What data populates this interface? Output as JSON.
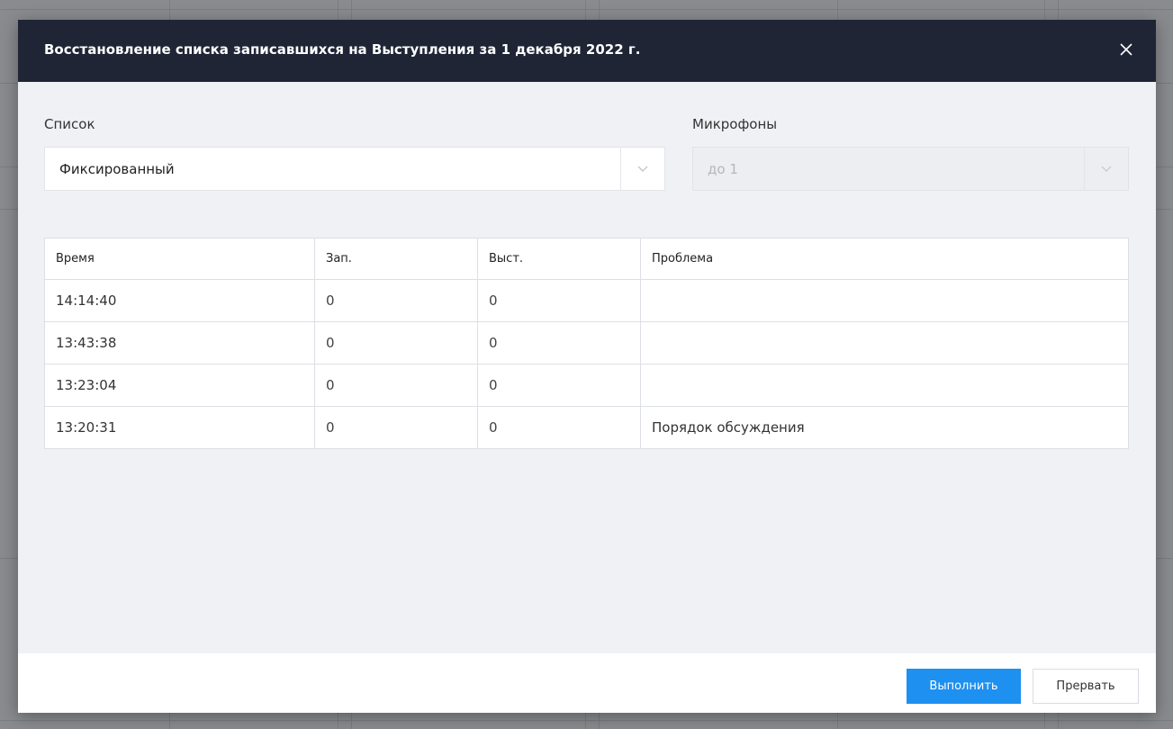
{
  "dialog": {
    "title": "Восстановление списка записавшихся на Выступления за 1 декабря 2022 г.",
    "close_icon": "close-icon"
  },
  "form": {
    "list_label": "Список",
    "list_value": "Фиксированный",
    "mics_label": "Микрофоны",
    "mics_value": "до 1"
  },
  "table": {
    "columns": [
      "Время",
      "Зап.",
      "Выст.",
      "Проблема"
    ],
    "rows": [
      [
        "14:14:40",
        "0",
        "0",
        ""
      ],
      [
        "13:43:38",
        "0",
        "0",
        ""
      ],
      [
        "13:23:04",
        "0",
        "0",
        ""
      ],
      [
        "13:20:31",
        "0",
        "0",
        "Порядок обсуждения"
      ]
    ]
  },
  "footer": {
    "execute_label": "Выполнить",
    "abort_label": "Прервать"
  },
  "colors": {
    "header_bg": "#1f2535",
    "primary": "#1e90f0",
    "modal_bg": "#eff1f5"
  }
}
